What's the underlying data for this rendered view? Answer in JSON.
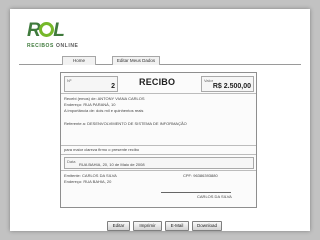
{
  "logo": {
    "word_r": "R",
    "word_l": "L",
    "sub1": "RECIBOS",
    "sub2": "ONLINE"
  },
  "nav": {
    "home": "Home",
    "edit_data": "Editar Meus Dados"
  },
  "receipt": {
    "number_caption": "Nº",
    "number": "2",
    "title": "RECIBO",
    "value_caption": "Valor",
    "value": "R$ 2.500,00",
    "lines": [
      "Recebi (emos) de: ANTONY VIANA CARLOS",
      "Endereço: RUA PARANÁ, 10",
      "A importância de: dois mil e quinhentos reais",
      "Referente a: DESENVOLVIMENTO DE SISTEMA DE INFORMAÇÃO"
    ],
    "declaration": "para maior clareza firmo o presente recibo",
    "date_caption": "Data",
    "date_line": "RUA BAHIA, 20, 10 de Maio de 2008",
    "issuer_line": "Emitente: CARLOS DA SILVA",
    "issuer_address": "Endereço: RUA BAHIA, 20",
    "cpf_line": "CPF: 96386393880",
    "signature_name": "CARLOS DA SILVA"
  },
  "buttons": {
    "edit": "Editar",
    "print": "Imprimir",
    "email": "E-Mail",
    "download": "Download"
  }
}
